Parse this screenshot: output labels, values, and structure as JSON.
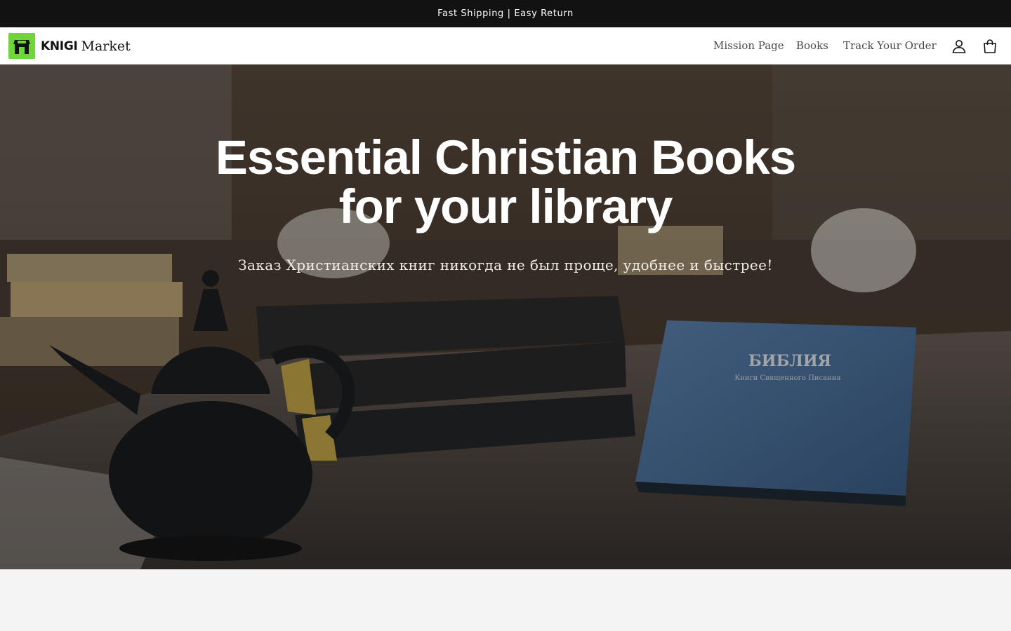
{
  "announcement": {
    "text": "Fast Shipping | Easy Return"
  },
  "header": {
    "logo_bold": "KNIGI",
    "logo_light": "Market",
    "nav": [
      {
        "label": "Mission Page"
      },
      {
        "label": "Books"
      },
      {
        "label": "Track Your Order"
      }
    ],
    "icons": {
      "account": "account-icon",
      "cart": "cart-icon",
      "logo": "shop-icon"
    }
  },
  "hero": {
    "title": "Essential Christian Books for your library",
    "subtitle": "Заказ Христианских книг никогда не был проще, удобнее и быстрее!",
    "book_title": "БИБЛИЯ",
    "book_subtitle": "Книги Священного Писания"
  },
  "colors": {
    "announcement_bg": "#121212",
    "logo_green": "#6fd53b",
    "page_bg": "#f4f4f4"
  }
}
